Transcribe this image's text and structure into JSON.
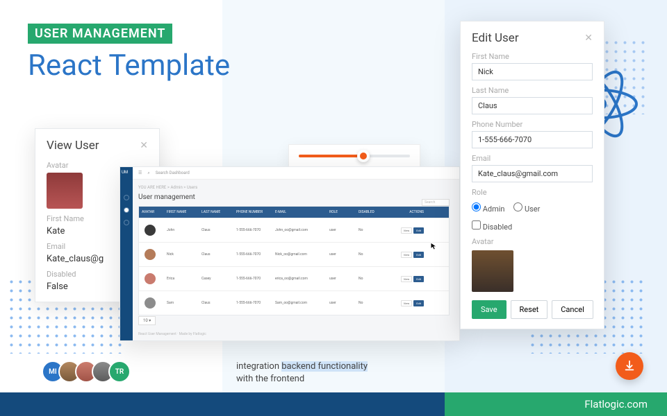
{
  "hero": {
    "badge": "USER MANAGEMENT",
    "title": "React Template"
  },
  "view_user": {
    "title": "View User",
    "labels": {
      "avatar": "Avatar",
      "first_name": "First Name",
      "email": "Email",
      "disabled": "Disabled"
    },
    "values": {
      "first_name": "Kate",
      "email": "Kate_claus@g",
      "disabled": "False"
    }
  },
  "edit_user": {
    "title": "Edit User",
    "labels": {
      "first_name": "First Name",
      "last_name": "Last Name",
      "phone": "Phone Number",
      "email": "Email",
      "role": "Role",
      "avatar": "Avatar"
    },
    "values": {
      "first_name": "Nick",
      "last_name": "Claus",
      "phone": "1-555-666-7070",
      "email": "Kate_claus@gmail.com"
    },
    "role": {
      "admin_label": "Admin",
      "user_label": "User",
      "admin_checked": true,
      "user_checked": false
    },
    "disabled_label": "Disabled",
    "disabled_checked": false,
    "buttons": {
      "save": "Save",
      "reset": "Reset",
      "cancel": "Cancel"
    }
  },
  "dashboard": {
    "logo": "UM",
    "search_placeholder": "Search Dashboard",
    "breadcrumb": "YOU ARE HERE  >  Admin  >  Users",
    "heading": "User management",
    "search_label": "Search",
    "columns": [
      "AVATAR",
      "FIRST NAME",
      "LAST NAME",
      "PHONE NUMBER",
      "E-MAIL",
      "ROLE",
      "DISABLED",
      "ACTIONS"
    ],
    "rows": [
      {
        "first": "John",
        "last": "Claus",
        "phone": "1-555-666-7070",
        "email": "John_oo@gmail.com",
        "role": "user",
        "disabled": "No"
      },
      {
        "first": "Nick",
        "last": "Claus",
        "phone": "1-555-666-7070",
        "email": "Nick_oo@gmail.com",
        "role": "user",
        "disabled": "No"
      },
      {
        "first": "Erica",
        "last": "Casey",
        "phone": "1-555-666-7070",
        "email": "erica_oo@gmail.com",
        "role": "user",
        "disabled": "No"
      },
      {
        "first": "Sam",
        "last": "Claus",
        "phone": "1-555-666-7070",
        "email": "Sam_oo@gmail.com",
        "role": "user",
        "disabled": "No"
      }
    ],
    "action_view": "View",
    "action_edit": "Edit",
    "pager": "10 ▾",
    "footer": "React User Management · Made by Flatlogic"
  },
  "caption": {
    "line1_pre": "integration ",
    "line1_hl": "backend functionality",
    "line2": "with the frontend"
  },
  "avatars": [
    "MI",
    "",
    "",
    "",
    "TR"
  ],
  "brand": "Flatlogic.com"
}
